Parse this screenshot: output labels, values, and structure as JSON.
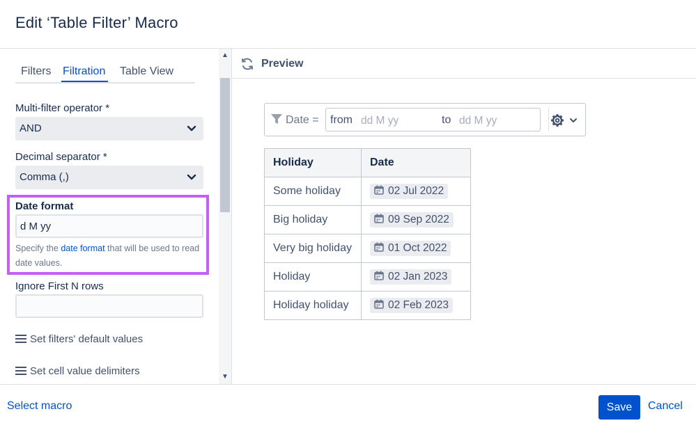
{
  "dialog": {
    "title": "Edit ‘Table Filter’ Macro"
  },
  "tabs": [
    {
      "label": "Filters",
      "active": false
    },
    {
      "label": "Filtration",
      "active": true
    },
    {
      "label": "Table View",
      "active": false
    }
  ],
  "settings": {
    "multi_filter_operator": {
      "label": "Multi-filter operator *",
      "value": "AND"
    },
    "decimal_separator": {
      "label": "Decimal separator *",
      "value": "Comma (,)"
    },
    "date_format": {
      "label": "Date format",
      "value": "d M yy",
      "help_prefix": "Specify the",
      "help_link": "date format",
      "help_suffix": "that will be used to read date values."
    },
    "ignore_first_n_rows": {
      "label": "Ignore First N rows",
      "value": ""
    },
    "links": [
      {
        "label": "Set filters' default values",
        "icon": "hamburger-icon"
      },
      {
        "label": "Set cell value delimiters",
        "icon": "hamburger-icon"
      }
    ]
  },
  "preview": {
    "title": "Preview",
    "filter": {
      "label": "Date =",
      "from_label": "from",
      "from_placeholder": "dd M yy",
      "to_label": "to",
      "to_placeholder": "dd M yy"
    },
    "table": {
      "headers": [
        "Holiday",
        "Date"
      ],
      "rows": [
        {
          "holiday": "Some holiday",
          "date": "02 Jul 2022"
        },
        {
          "holiday": "Big holiday",
          "date": "09 Sep 2022"
        },
        {
          "holiday": "Very big holiday",
          "date": "01 Oct 2022"
        },
        {
          "holiday": "Holiday",
          "date": "02 Jan 2023"
        },
        {
          "holiday": "Holiday holiday",
          "date": "02 Feb 2023"
        }
      ]
    }
  },
  "footer": {
    "select_macro": "Select macro",
    "save": "Save",
    "cancel": "Cancel"
  },
  "colors": {
    "accent": "#0052cc",
    "highlight": "#c660f5"
  }
}
